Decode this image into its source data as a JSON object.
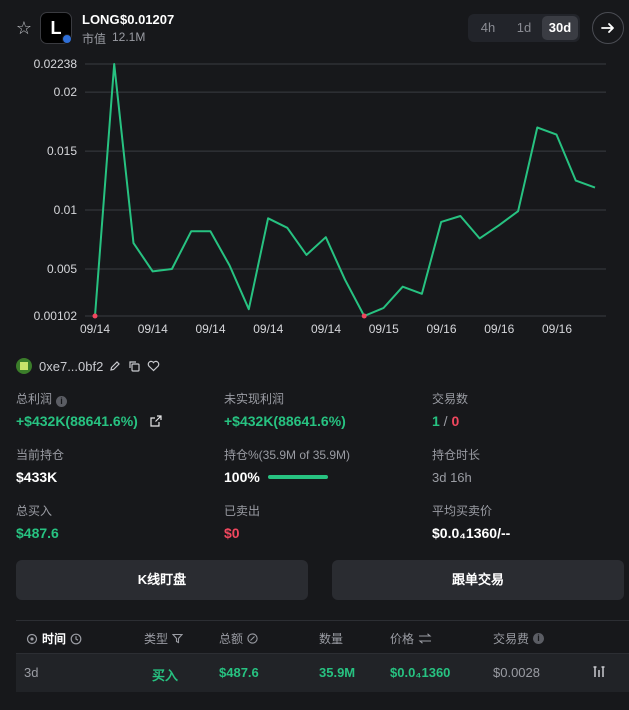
{
  "header": {
    "logo_letter": "L",
    "symbol": "LONG",
    "price": "$0.01207",
    "mcap_label": "市值",
    "mcap_value": "12.1M",
    "timeframes": [
      "4h",
      "1d",
      "30d"
    ],
    "active_timeframe": "30d"
  },
  "chart_data": {
    "type": "line",
    "y_ticks": [
      "0.02238",
      "0.02",
      "0.015",
      "0.01",
      "0.005",
      "0.00102"
    ],
    "ylim": [
      0.00102,
      0.02238
    ],
    "grid": true,
    "x_ticks": [
      "09/14",
      "09/14",
      "09/14",
      "09/14",
      "09/14",
      "09/15",
      "09/16",
      "09/16",
      "09/16"
    ],
    "values": [
      0.00102,
      0.02238,
      0.0072,
      0.0048,
      0.005,
      0.0082,
      0.0082,
      0.0053,
      0.0016,
      0.0093,
      0.0085,
      0.0062,
      0.0077,
      0.0041,
      0.00102,
      0.0017,
      0.0035,
      0.0029,
      0.009,
      0.0095,
      0.0076,
      0.0087,
      0.0099,
      0.017,
      0.0164,
      0.0125,
      0.0119
    ],
    "line_color": "#27c281",
    "marker_color": "#f0475e"
  },
  "wallet": {
    "address": "0xe7...0bf2"
  },
  "stats": {
    "total_profit_label": "总利润",
    "total_profit_value": "+$432K(88641.6%)",
    "unrealized_label": "未实现利润",
    "unrealized_value": "+$432K(88641.6%)",
    "trades_label": "交易数",
    "trades_buy": "1",
    "trades_sep": " / ",
    "trades_sell": "0",
    "holding_label": "当前持仓",
    "holding_value": "$433K",
    "hold_pct_label": "持仓%(35.9M of 35.9M)",
    "hold_pct_value": "100%",
    "hold_pct_fraction": 1.0,
    "hold_time_label": "持仓时长",
    "hold_time_value": "3d 16h",
    "bought_label": "总买入",
    "bought_value": "$487.6",
    "sold_label": "已卖出",
    "sold_value": "$0",
    "avg_price_label": "平均买卖价",
    "avg_price_value": "$0.0₄1360/--"
  },
  "buttons": {
    "kline": "K线盯盘",
    "copy_trade": "跟单交易"
  },
  "table": {
    "headers": {
      "time": "时间",
      "type": "类型",
      "amount": "总额",
      "qty": "数量",
      "price": "价格",
      "fee": "交易费"
    },
    "rows": [
      {
        "time": "3d",
        "type": "买入",
        "amount": "$487.6",
        "qty": "35.9M",
        "price": "$0.0₄1360",
        "fee": "$0.0028"
      }
    ]
  },
  "colors": {
    "green": "#27c281",
    "red": "#f0475e",
    "background": "#17181b"
  }
}
